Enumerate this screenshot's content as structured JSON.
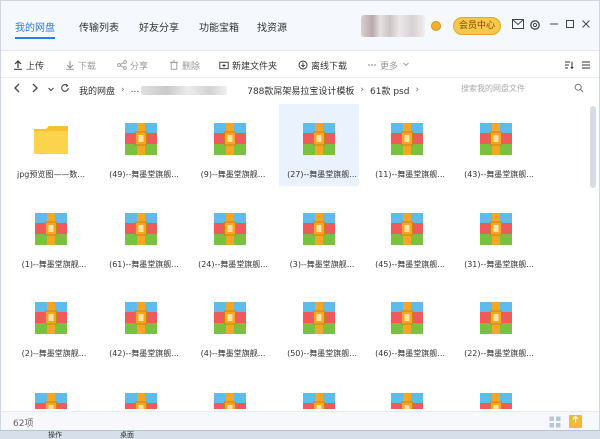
{
  "nav": {
    "tabs": [
      {
        "label": "我的网盘",
        "active": true
      },
      {
        "label": "传输列表"
      },
      {
        "label": "好友分享"
      },
      {
        "label": "功能宝箱"
      },
      {
        "label": "找资源"
      }
    ],
    "member_label": "会员中心",
    "icons": [
      "mail-icon",
      "settings-icon",
      "minimize-icon",
      "maximize-icon",
      "close-icon"
    ]
  },
  "toolbar": {
    "upload": "上传",
    "download": "下载",
    "share": "分享",
    "delete": "删除",
    "new_folder": "新建文件夹",
    "offline_download": "离线下载",
    "more": "更多"
  },
  "address": {
    "crumbs": [
      "我的网盘",
      "...",
      "788款屌架易拉宝设计模板",
      "61款 psd"
    ],
    "search_placeholder": "搜索我的网盘文件"
  },
  "files": [
    {
      "label": "jpg预览图——数...",
      "type": "folder"
    },
    {
      "label": "(49)--舞墨堂旗舰...",
      "type": "archive"
    },
    {
      "label": "(9)--舞墨堂旗舰...",
      "type": "archive"
    },
    {
      "label": "(27)--舞墨堂旗舰...",
      "type": "archive",
      "selected": true
    },
    {
      "label": "(11)--舞墨堂旗舰...",
      "type": "archive"
    },
    {
      "label": "(43)--舞墨堂旗舰...",
      "type": "archive"
    },
    {
      "label": "(1)--舞墨堂旗舰...",
      "type": "archive"
    },
    {
      "label": "(61)--舞墨堂旗舰...",
      "type": "archive"
    },
    {
      "label": "(24)--舞墨堂旗舰...",
      "type": "archive"
    },
    {
      "label": "(3)--舞墨堂旗舰...",
      "type": "archive"
    },
    {
      "label": "(45)--舞墨堂旗舰...",
      "type": "archive"
    },
    {
      "label": "(31)--舞墨堂旗舰...",
      "type": "archive"
    },
    {
      "label": "(2)--舞墨堂旗舰...",
      "type": "archive"
    },
    {
      "label": "(42)--舞墨堂旗舰...",
      "type": "archive"
    },
    {
      "label": "(4)--舞墨堂旗舰...",
      "type": "archive"
    },
    {
      "label": "(50)--舞墨堂旗舰...",
      "type": "archive"
    },
    {
      "label": "(46)--舞墨堂旗舰...",
      "type": "archive"
    },
    {
      "label": "(22)--舞墨堂旗舰...",
      "type": "archive"
    },
    {
      "label": "",
      "type": "archive"
    },
    {
      "label": "",
      "type": "archive"
    },
    {
      "label": "",
      "type": "archive"
    },
    {
      "label": "",
      "type": "archive"
    },
    {
      "label": "",
      "type": "archive"
    },
    {
      "label": "",
      "type": "archive"
    }
  ],
  "status": {
    "count": "62项"
  },
  "taskbar": {
    "items": [
      "操作",
      "桌面"
    ]
  },
  "colors": {
    "accent": "#2f7de1",
    "member_gold": "#f6c84a",
    "archive_blue": "#5ebcea",
    "archive_red": "#ef5b5b",
    "archive_green": "#7ac142",
    "archive_orange": "#f5a623",
    "folder_yellow": "#f7c12e"
  }
}
